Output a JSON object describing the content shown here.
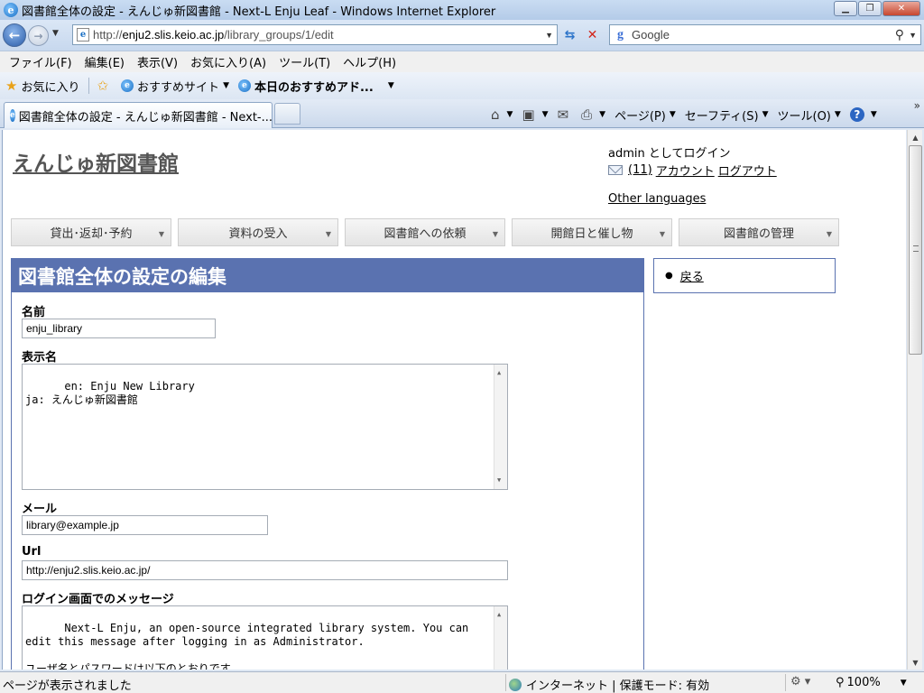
{
  "window": {
    "title": "図書館全体の設定 - えんじゅ新図書館 - Next-L Enju Leaf - Windows Internet Explorer"
  },
  "addressbar": {
    "url_prefix": "http://",
    "url_host": "enju2.slis.keio.ac.jp",
    "url_path": "/library_groups/1/edit",
    "search_value": "Google"
  },
  "menubar": {
    "items": [
      "ファイル(F)",
      "編集(E)",
      "表示(V)",
      "お気に入り(A)",
      "ツール(T)",
      "ヘルプ(H)"
    ]
  },
  "favorites": {
    "label": "お気に入り",
    "suggested": "おすすめサイト",
    "daily": "本日のおすすめアド..."
  },
  "tabs": {
    "active": "図書館全体の設定 - えんじゅ新図書館 - Next-..."
  },
  "commandbar": {
    "page": "ページ(P)",
    "safety": "セーフティ(S)",
    "tools": "ツール(O)",
    "chevron": "»"
  },
  "page": {
    "site_title": "えんじゅ新図書館",
    "login_info": "admin としてログイン",
    "message_count": "(11)",
    "account_link": "アカウント",
    "logout_link": "ログアウト",
    "other_languages": "Other languages",
    "nav": [
      "貸出･返却･予約",
      "資料の受入",
      "図書館への依頼",
      "開館日と催し物",
      "図書館の管理"
    ],
    "heading": "図書館全体の設定の編集",
    "back_link": "戻る",
    "form": {
      "name_label": "名前",
      "name_value": "enju_library",
      "display_name_label": "表示名",
      "display_name_value": "en: Enju New Library\nja: えんじゅ新図書館",
      "email_label": "メール",
      "email_value": "library@example.jp",
      "url_label": "Url",
      "url_value": "http://enju2.slis.keio.ac.jp/",
      "login_message_label": "ログイン画面でのメッセージ",
      "login_message_value": "Next-L Enju, an open-source integrated library system. You can\nedit this message after logging in as Administrator.\n\nユーザ名とパスワードは以下のとおりです。"
    }
  },
  "statusbar": {
    "status": "ページが表示されました",
    "zone": "インターネット | 保護モード: 有効",
    "zoom": "100%"
  },
  "colors": {
    "heading_bg": "#5a72b0",
    "chrome_bg": "#dfe8f4"
  }
}
